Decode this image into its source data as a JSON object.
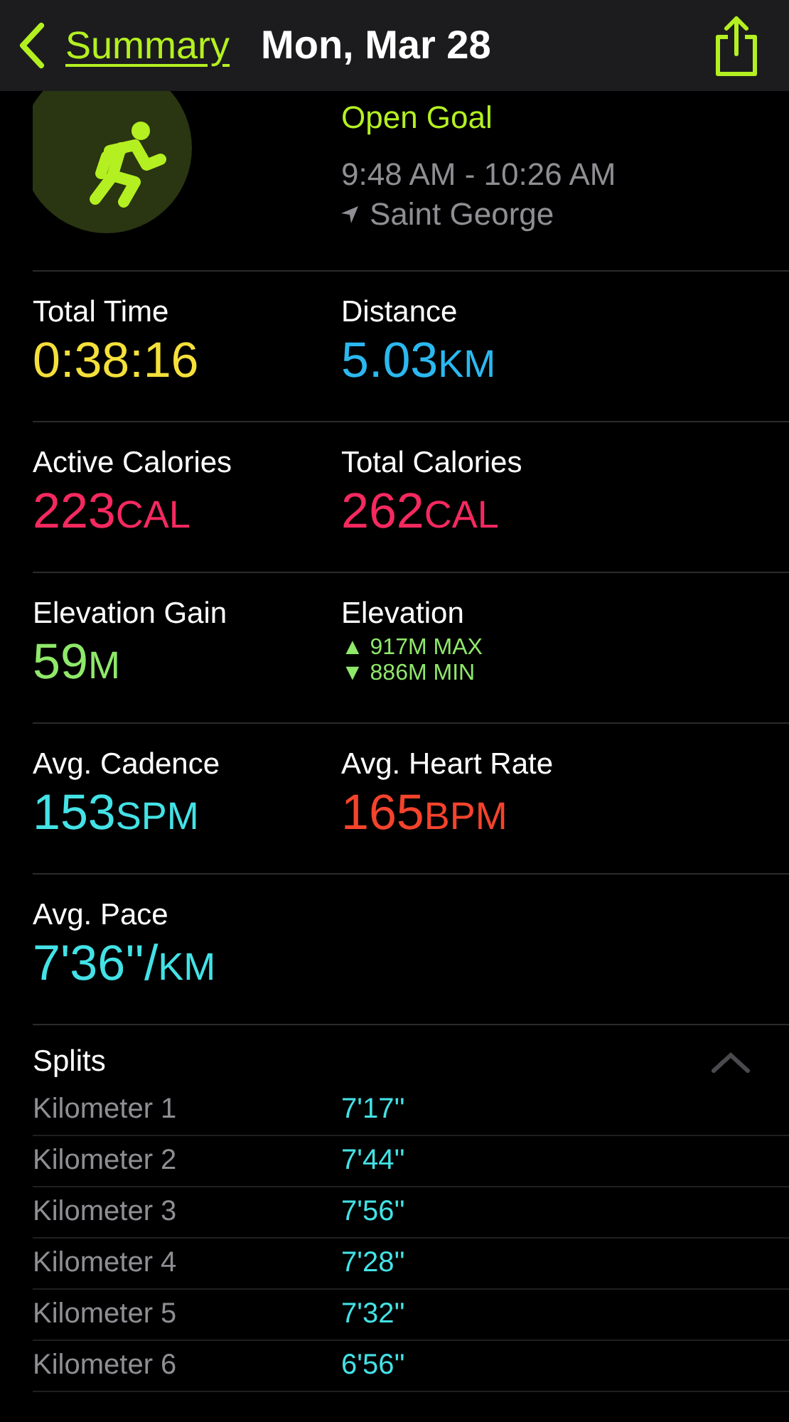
{
  "nav": {
    "back": "Summary",
    "title": "Mon, Mar 28"
  },
  "workout": {
    "goal": "Open Goal",
    "time": "9:48 AM - 10:26 AM",
    "location": "Saint George"
  },
  "metric_rows": [
    [
      {
        "kind": "value",
        "label": "Total Time",
        "value": "0:38:16",
        "color": "#f5e03a"
      },
      {
        "kind": "value",
        "label": "Distance",
        "value": "5.03",
        "unit": "KM",
        "color": "#2bb8f0"
      }
    ],
    [
      {
        "kind": "value",
        "label": "Active Calories",
        "value": "223",
        "unit": "CAL",
        "color": "#f5295f"
      },
      {
        "kind": "value",
        "label": "Total Calories",
        "value": "262",
        "unit": "CAL",
        "color": "#f5295f"
      }
    ],
    [
      {
        "kind": "value",
        "label": "Elevation Gain",
        "value": "59",
        "unit": "M",
        "color": "#8fe86a"
      },
      {
        "kind": "range",
        "label": "Elevation",
        "max": "▲ 917M MAX",
        "min": "▼ 886M MIN",
        "color": "#8fe86a"
      }
    ],
    [
      {
        "kind": "value",
        "label": "Avg. Cadence",
        "value": "153",
        "unit": "SPM",
        "color": "#43e2e6"
      },
      {
        "kind": "value",
        "label": "Avg. Heart Rate",
        "value": "165",
        "unit": "BPM",
        "color": "#f5432c"
      }
    ],
    [
      {
        "kind": "value",
        "label": "Avg. Pace",
        "value": "7'36''/",
        "unit": "KM",
        "color": "#43e2e6"
      }
    ]
  ],
  "splits": {
    "title": "Splits",
    "expanded": true,
    "rows": [
      {
        "label": "Kilometer 1",
        "pace": "7'17''"
      },
      {
        "label": "Kilometer 2",
        "pace": "7'44''"
      },
      {
        "label": "Kilometer 3",
        "pace": "7'56''"
      },
      {
        "label": "Kilometer 4",
        "pace": "7'28''"
      },
      {
        "label": "Kilometer 5",
        "pace": "7'32''"
      },
      {
        "label": "Kilometer 6",
        "pace": "6'56''"
      }
    ]
  }
}
